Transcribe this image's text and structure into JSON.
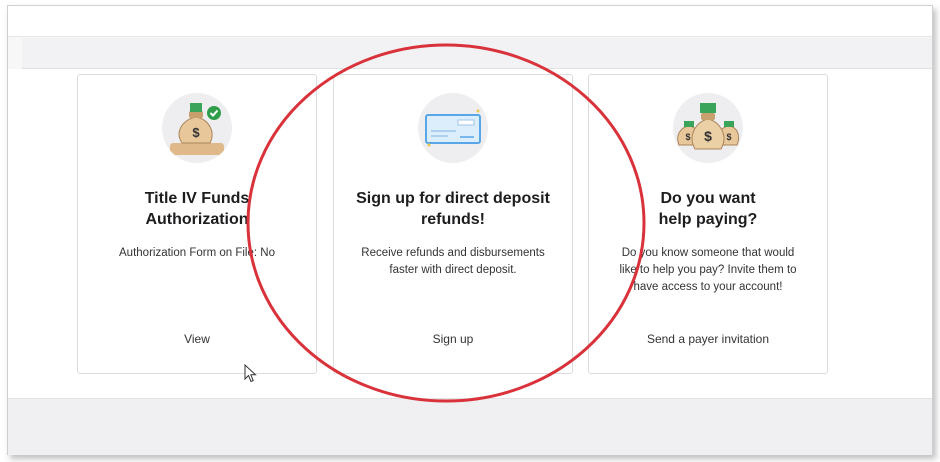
{
  "cards": [
    {
      "icon": "money-bag-check-icon",
      "title_line1": "Title IV Funds",
      "title_line2": "Authorization",
      "desc_line1": "Authorization Form on File: No",
      "desc_line2": "",
      "desc_line3": "",
      "action": "View"
    },
    {
      "icon": "check-document-icon",
      "title_line1": "Sign up for direct deposit",
      "title_line2": "refunds!",
      "desc_line1": "Receive refunds and disbursements",
      "desc_line2": "faster with direct deposit.",
      "desc_line3": "",
      "action": "Sign up"
    },
    {
      "icon": "money-bags-icon",
      "title_line1": "Do you want",
      "title_line2": "help paying?",
      "desc_line1": "Do you know someone that would",
      "desc_line2": "like to help you pay? Invite them to",
      "desc_line3": "have access to your account!",
      "action": "Send a payer invitation"
    }
  ],
  "colors": {
    "annotation_circle": "#d9323a",
    "bag": "#e8c79a",
    "money": "#3aa55a",
    "check_blue": "#58a6e8"
  }
}
